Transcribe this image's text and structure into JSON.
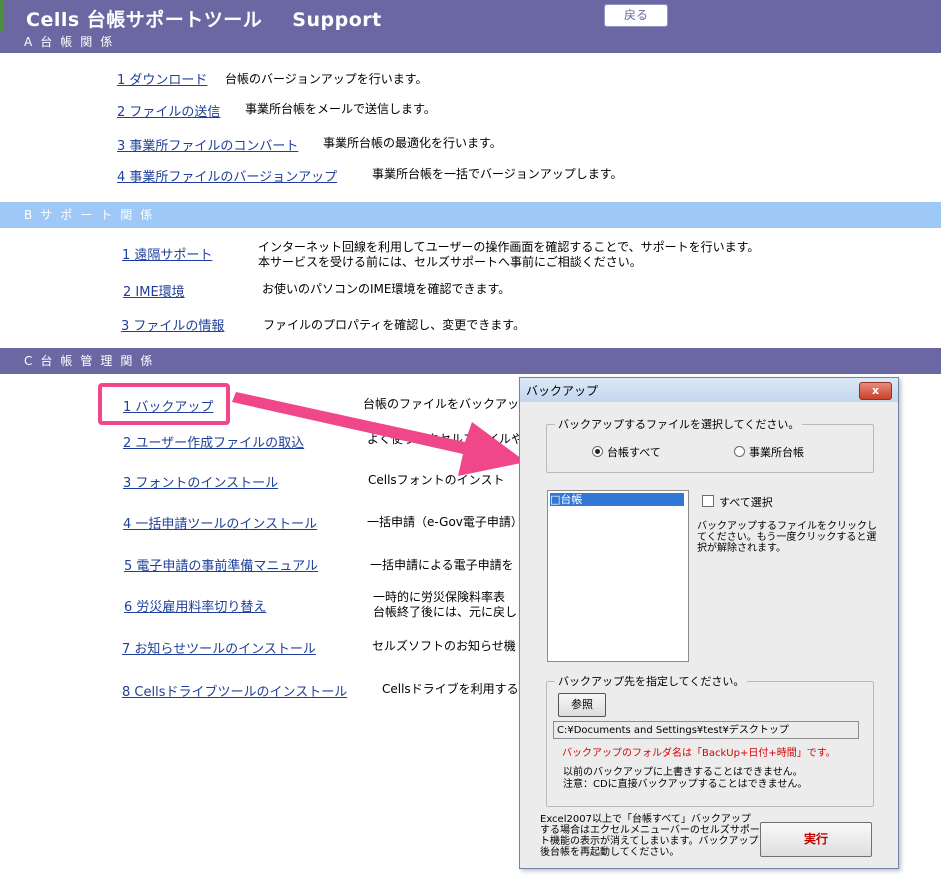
{
  "header": {
    "title": "Cells  台帳サポートツール",
    "subtitle": "Support",
    "back_button": "戻る"
  },
  "sections": {
    "a": {
      "title": "A台帳関係",
      "items": [
        {
          "link": "1 ダウンロード",
          "desc": "台帳のバージョンアップを行います。"
        },
        {
          "link": "2 ファイルの送信",
          "desc": "事業所台帳をメールで送信します。"
        },
        {
          "link": "3 事業所ファイルのコンバート",
          "desc": "事業所台帳の最適化を行います。"
        },
        {
          "link": "4 事業所ファイルのバージョンアップ",
          "desc": "事業所台帳を一括でバージョンアップします。"
        }
      ]
    },
    "b": {
      "title": "Bサポート関係",
      "items": [
        {
          "link": "1 遠隔サポート",
          "desc": "インターネット回線を利用してユーザーの操作画面を確認することで、サポートを行います。",
          "desc2": "本サービスを受ける前には、セルズサポートへ事前にご相談ください。"
        },
        {
          "link": "2 IME環境",
          "desc": "お使いのパソコンのIME環境を確認できます。"
        },
        {
          "link": "3 ファイルの情報",
          "desc": "ファイルのプロパティを確認し、変更できます。"
        }
      ]
    },
    "c": {
      "title": "C台帳管理関係",
      "items": [
        {
          "link": "1 バックアップ",
          "desc": "台帳のファイルをバックアッ"
        },
        {
          "link": "2 ユーザー作成ファイルの取込",
          "desc": "よく使うエクセルファイルや、"
        },
        {
          "link": "3 フォントのインストール",
          "desc": "Cellsフォントのインスト"
        },
        {
          "link": "4 一括申請ツールのインストール",
          "desc": "一括申請（e-Gov電子申請）"
        },
        {
          "link": "5 電子申請の事前準備マニュアル",
          "desc": "一括申請による電子申請を"
        },
        {
          "link": "6 労災雇用料率切り替え",
          "desc": "一時的に労災保険料率表",
          "desc2": "台帳終了後には、元に戻し"
        },
        {
          "link": "7 お知らせツールのインストール",
          "desc": "セルズソフトのお知らせ機"
        },
        {
          "link": "8 Cellsドライブツールのインストール",
          "desc": "Cellsドライブを利用する際"
        }
      ]
    }
  },
  "dialog": {
    "title": "バックアップ",
    "close": "x",
    "group1_legend": "バックアップするファイルを選択してください。",
    "radio_all": "台帳すべて",
    "radio_office": "事業所台帳",
    "list_items": [
      "□台帳"
    ],
    "select_all": "すべて選択",
    "help_text": "バックアップするファイルをクリックしてください。もう一度クリックすると選択が解除されます。",
    "group2_legend": "バックアップ先を指定してください。",
    "browse": "参照",
    "path": "C:¥Documents and Settings¥test¥デスクトップ",
    "folder_note": "バックアップのフォルダ名は「BackUp+日付+時間」です。",
    "note1": "以前のバックアップに上書きすることはできません。",
    "note2": "注意：CDに直接バックアップすることはできません。",
    "footer": "Excel2007以上で「台帳すべて」バックアップする場合はエクセルメニューバーのセルズサポート機能の表示が消えてしまいます。バックアップ後台帳を再起動してください。",
    "execute": "実行"
  },
  "colors": {
    "header_bg": "#6b67a3",
    "section_b_bg": "#9ec9f6",
    "link": "#1f3f9a",
    "highlight": "#f0478a",
    "warning_text": "#d80000"
  }
}
